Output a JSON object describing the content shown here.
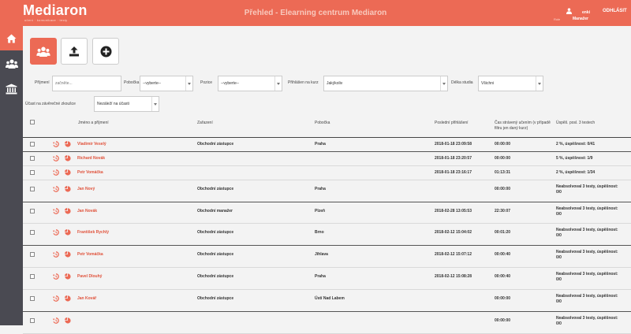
{
  "header": {
    "logo": "Mediaron",
    "logo_sub": "učení · komunikace · testy",
    "title": "Přehled - Elearning centrum Mediaron",
    "user_name": "enki",
    "role_label": "Role",
    "role": "Manažer",
    "logout": "ODHLÁSIT"
  },
  "sidebar": {
    "items": [
      {
        "name": "home",
        "icon": "home-icon"
      },
      {
        "name": "users",
        "icon": "users-icon"
      },
      {
        "name": "institution",
        "icon": "bank-icon"
      }
    ]
  },
  "tabs": [
    {
      "name": "users",
      "icon": "users-icon",
      "active": true
    },
    {
      "name": "upload",
      "icon": "upload-icon"
    },
    {
      "name": "add",
      "icon": "plus-icon"
    }
  ],
  "filters": {
    "surname_label": "Příjmení",
    "surname_placeholder": "začněte...",
    "branch_label": "Pobočka",
    "branch_value": "--vyberte--",
    "position_label": "Pozice",
    "position_value": "--vyberte--",
    "course_label": "Přihlášen na kurz",
    "course_value": "Jakýkoliv",
    "length_label": "Délka studia",
    "length_value": "Všichni",
    "final_test_label": "Účast na závěrečné zkoušce",
    "final_test_value": "Nezáleží na účasti"
  },
  "table": {
    "headers": {
      "name": "Jméno a příjmení",
      "position": "Zařazení",
      "branch": "Pobočka",
      "last_login": "Poslední přihlášení",
      "time": "Čas strávený učením (v případě filtru jen daný kurz)",
      "success": "Úspěš. posl. 3 testech"
    },
    "rows": [
      {
        "name": "Vladimír Veselý",
        "position": "Obchodní zástupce",
        "branch": "Praha",
        "login": "2018-01-18 23:09:58",
        "time": "00:00:00",
        "success": "2 %, úspěšnost: 0/41"
      },
      {
        "name": "Richard Novák",
        "position": "",
        "branch": "",
        "login": "2018-01-18 23:20:57",
        "time": "00:00:00",
        "success": "5 %, úspěšnost: 1/9"
      },
      {
        "name": "Petr Vomáčka",
        "position": "",
        "branch": "",
        "login": "2018-01-18 23:16:17",
        "time": "01:13:31",
        "success": "2 %, úspěšnost: 1/34"
      },
      {
        "name": "Jan Nový",
        "position": "Obchodní zástupce",
        "branch": "Praha",
        "login": "",
        "time": "00:00:00",
        "success": "Neabsolvoval 3 testy, úspěšnost: 0/0"
      },
      {
        "name": "Jan Novák",
        "position": "Obchodní manažer",
        "branch": "Plzeň",
        "login": "2018-02-28 13:05:53",
        "time": "22:30:07",
        "success": "Neabsolvoval 3 testy, úspěšnost: 0/0"
      },
      {
        "name": "František Rychlý",
        "position": "Obchodní zástupce",
        "branch": "Brno",
        "login": "2018-02-12 15:04:02",
        "time": "00:01:20",
        "success": "Neabsolvoval 3 testy, úspěšnost: 0/0"
      },
      {
        "name": "Petr Vomáčka",
        "position": "Obchodní zástupce",
        "branch": "Jihlava",
        "login": "2018-02-12 15:07:12",
        "time": "00:00:40",
        "success": "Neabsolvoval 3 testy, úspěšnost: 0/0"
      },
      {
        "name": "Pavel Dlouhý",
        "position": "Obchodní zástupce",
        "branch": "Praha",
        "login": "2018-02-12 15:08:28",
        "time": "00:00:40",
        "success": "Neabsolvoval 3 testy, úspěšnost: 0/0"
      },
      {
        "name": "Jan Kovář",
        "position": "Obchodní zástupce",
        "branch": "Ústí Nad Labem",
        "login": "",
        "time": "00:00:00",
        "success": "Neabsolvoval 3 testy, úspěšnost: 0/0"
      },
      {
        "name": "",
        "position": "",
        "branch": "",
        "login": "",
        "time": "00:00:00",
        "success": "Neabsolvoval 3 testy, úspěšnost: 0/0"
      }
    ]
  },
  "colors": {
    "accent": "#ec6a55",
    "sidebar": "#4a4a52",
    "name": "#e0523b"
  }
}
